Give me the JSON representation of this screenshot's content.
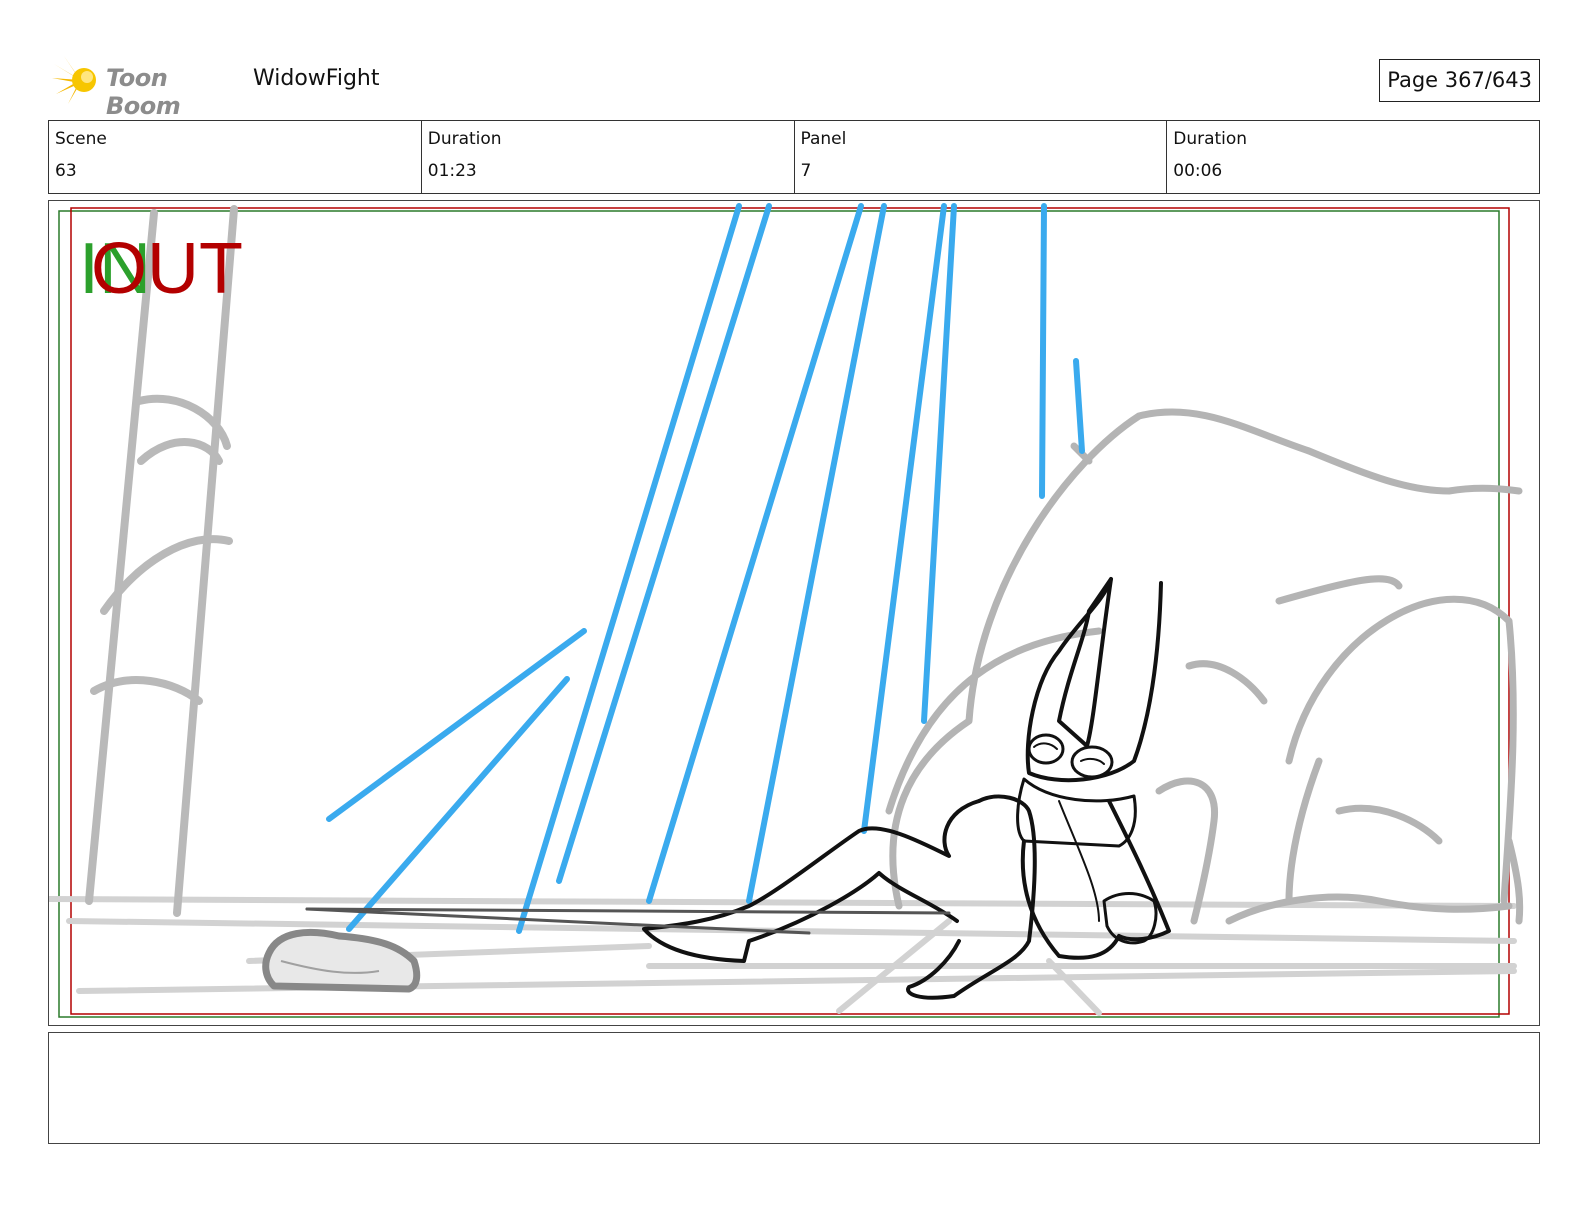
{
  "header": {
    "logo_text": "Toon Boom",
    "project_name": "WidowFight",
    "page_label": "Page 367/643"
  },
  "info": {
    "scene_label": "Scene",
    "scene_value": "63",
    "scene_duration_label": "Duration",
    "scene_duration_value": "01:23",
    "panel_label": "Panel",
    "panel_value": "7",
    "panel_duration_label": "Duration",
    "panel_duration_value": "00:06"
  },
  "panel": {
    "in_marker": "IN",
    "out_marker": "OUT",
    "colors": {
      "in": "#2ca02c",
      "out": "#b30000",
      "light_beams": "#3aaaee",
      "background_sketch": "#b4b4b4",
      "character": "#111111"
    }
  },
  "notes": {
    "text": ""
  }
}
